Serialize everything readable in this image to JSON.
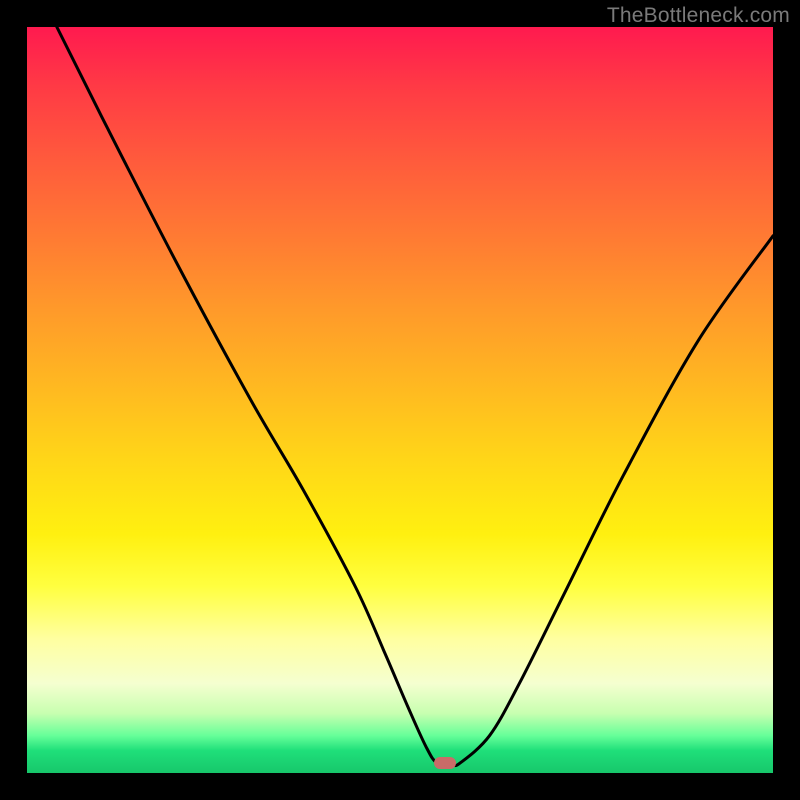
{
  "watermark": "TheBottleneck.com",
  "chart_data": {
    "type": "line",
    "title": "",
    "xlabel": "",
    "ylabel": "",
    "xlim": [
      0,
      100
    ],
    "ylim": [
      0,
      100
    ],
    "grid": false,
    "series": [
      {
        "name": "bottleneck-curve",
        "x": [
          4,
          10,
          20,
          30,
          37,
          44,
          48,
          51,
          53.5,
          55,
          57,
          58,
          62,
          66,
          72,
          80,
          90,
          100
        ],
        "values": [
          100,
          88,
          68.5,
          50,
          38,
          25,
          16,
          9,
          3.5,
          1.3,
          1.2,
          1.3,
          5,
          12,
          24,
          40,
          58,
          72
        ],
        "color": "#000000"
      }
    ],
    "marker": {
      "x": 56,
      "y": 1.3,
      "color": "#c96b68"
    },
    "background_gradient": {
      "top": "#ff1a4f",
      "mid_upper": "#ff9a2a",
      "mid": "#fff010",
      "mid_lower": "#ffffa0",
      "bottom": "#17c76b"
    }
  }
}
